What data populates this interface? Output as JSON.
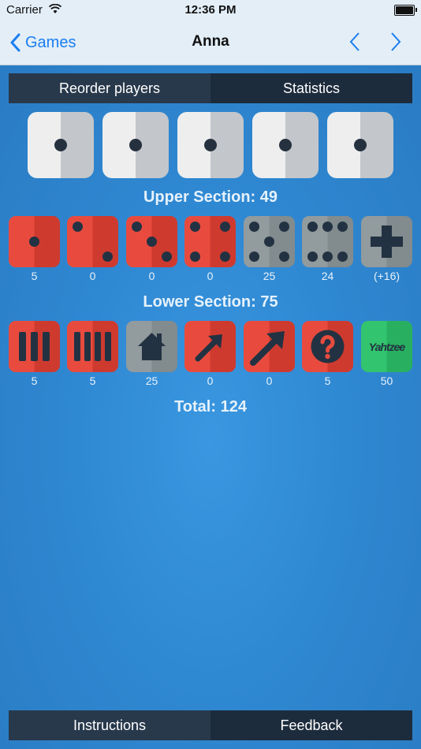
{
  "status": {
    "carrier": "Carrier",
    "time": "12:36 PM"
  },
  "nav": {
    "back_label": "Games",
    "title": "Anna"
  },
  "top_bar": {
    "reorder_label": "Reorder players",
    "statistics_label": "Statistics"
  },
  "rolled_dice": [
    1,
    1,
    1,
    1,
    1
  ],
  "upper": {
    "title": "Upper Section: 49",
    "items": [
      {
        "name": "ones",
        "value": "5"
      },
      {
        "name": "twos",
        "value": "0"
      },
      {
        "name": "threes",
        "value": "0"
      },
      {
        "name": "fours",
        "value": "0"
      },
      {
        "name": "fives",
        "value": "25"
      },
      {
        "name": "sixes",
        "value": "24"
      },
      {
        "name": "bonus",
        "value": "(+16)"
      }
    ]
  },
  "lower": {
    "title": "Lower Section: 75",
    "items": [
      {
        "name": "three-of-a-kind",
        "value": "5"
      },
      {
        "name": "four-of-a-kind",
        "value": "5"
      },
      {
        "name": "full-house",
        "value": "25"
      },
      {
        "name": "small-straight",
        "value": "0"
      },
      {
        "name": "large-straight",
        "value": "0"
      },
      {
        "name": "chance",
        "value": "5"
      },
      {
        "name": "yahtzee",
        "value": "50",
        "logo_text": "Yahtzee"
      }
    ]
  },
  "total": "Total: 124",
  "bottom_bar": {
    "instructions_label": "Instructions",
    "feedback_label": "Feedback"
  },
  "colors": {
    "red": "#e84b3e",
    "gray": "#929b9d",
    "green": "#32c46e",
    "accent": "#1a7ef0"
  }
}
